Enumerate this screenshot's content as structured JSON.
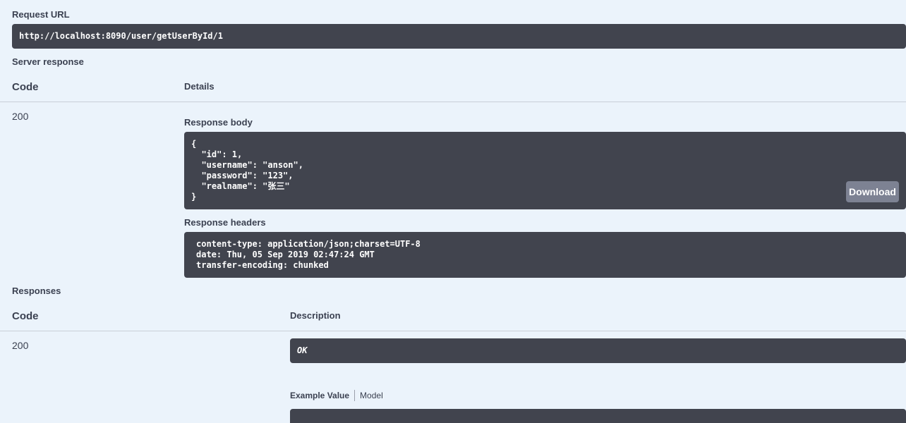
{
  "request_url": {
    "label": "Request URL",
    "value": "http://localhost:8090/user/getUserById/1"
  },
  "server_response": {
    "label": "Server response",
    "code_header": "Code",
    "details_header": "Details",
    "code": "200",
    "response_body": {
      "label": "Response body",
      "lines": [
        "{",
        "  \"id\": 1,",
        "  \"username\": \"anson\",",
        "  \"password\": \"123\",",
        "  \"realname\": \"张三\"",
        "}"
      ],
      "download_label": "Download"
    },
    "response_headers": {
      "label": "Response headers",
      "lines": [
        "content-type: application/json;charset=UTF-8",
        "date: Thu, 05 Sep 2019 02:47:24 GMT",
        "transfer-encoding: chunked"
      ]
    }
  },
  "responses": {
    "label": "Responses",
    "code_header": "Code",
    "description_header": "Description",
    "code": "200",
    "description": "OK",
    "tabs": {
      "example_value": "Example Value",
      "model": "Model"
    }
  },
  "colors": {
    "background": "#ebf3fb",
    "code_block": "#41444e",
    "download_button": "#7d8293",
    "text": "#3b4151"
  }
}
